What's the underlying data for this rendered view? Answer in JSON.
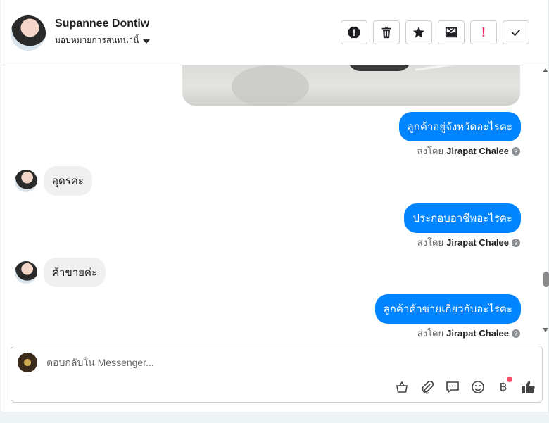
{
  "header": {
    "contact_name": "Supannee Dontiw",
    "assign_label": "มอบหมายการสนทนานี้",
    "tools": [
      {
        "name": "spam-icon"
      },
      {
        "name": "trash-icon"
      },
      {
        "name": "star-icon"
      },
      {
        "name": "mark-unread-icon"
      },
      {
        "name": "important-icon",
        "glyph": "!"
      },
      {
        "name": "check-icon"
      }
    ]
  },
  "messages": [
    {
      "dir": "out",
      "text": "ลูกค้าอยู่จังหวัดอะไรคะ",
      "sent_by_prefix": "ส่งโดย",
      "sent_by_name": "Jirapat Chalee"
    },
    {
      "dir": "in",
      "text": "อุดรค่ะ"
    },
    {
      "dir": "out",
      "text": "ประกอบอาชีพอะไรคะ",
      "sent_by_prefix": "ส่งโดย",
      "sent_by_name": "Jirapat Chalee"
    },
    {
      "dir": "in",
      "text": "ค้าขายค่ะ"
    },
    {
      "dir": "out",
      "text": "ลูกค้าค้าขายเกี่ยวกับอะไรคะ",
      "sent_by_prefix": "ส่งโดย",
      "sent_by_name": "Jirapat Chalee"
    }
  ],
  "composer": {
    "placeholder": "ตอบกลับใน Messenger...",
    "tools": [
      "basket-icon",
      "attach-icon",
      "saved-reply-icon",
      "emoji-icon",
      "baht-icon",
      "thumbs-up-icon"
    ],
    "baht_glyph": "฿"
  },
  "colors": {
    "accent": "#0084ff",
    "incoming": "#f0f0f0",
    "badge": "#f25268"
  }
}
